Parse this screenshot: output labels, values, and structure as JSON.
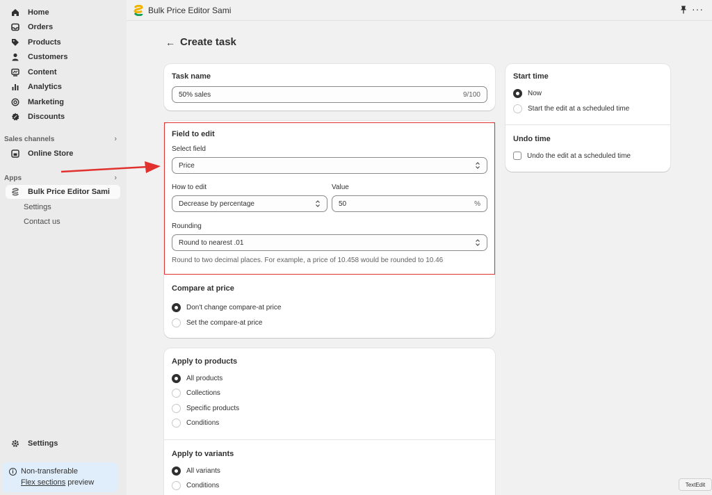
{
  "sidebar": {
    "items": [
      {
        "label": "Home",
        "icon": "home-icon"
      },
      {
        "label": "Orders",
        "icon": "orders-icon"
      },
      {
        "label": "Products",
        "icon": "tag-icon"
      },
      {
        "label": "Customers",
        "icon": "person-icon"
      },
      {
        "label": "Content",
        "icon": "content-icon"
      },
      {
        "label": "Analytics",
        "icon": "bar-chart-icon"
      },
      {
        "label": "Marketing",
        "icon": "target-icon"
      },
      {
        "label": "Discounts",
        "icon": "discount-icon"
      }
    ],
    "sales_channels_label": "Sales channels",
    "online_store": "Online Store",
    "apps_label": "Apps",
    "app_name": "Bulk Price Editor Sami",
    "app_settings": "Settings",
    "app_contact": "Contact us",
    "settings": "Settings",
    "notice_line1": "Non-transferable",
    "notice_link": "Flex sections",
    "notice_suffix": " preview"
  },
  "topbar": {
    "title": "Bulk Price Editor Sami"
  },
  "page": {
    "title": "Create task"
  },
  "task_name": {
    "title": "Task name",
    "value": "50% sales",
    "counter": "9/100"
  },
  "field_to_edit": {
    "title": "Field to edit",
    "select_label": "Select field",
    "select_value": "Price",
    "how_label": "How to edit",
    "how_value": "Decrease by percentage",
    "value_label": "Value",
    "value": "50",
    "value_suffix": "%",
    "rounding_label": "Rounding",
    "rounding_value": "Round to nearest .01",
    "rounding_help": "Round to two decimal places. For example, a price of 10.458 would be rounded to 10.46"
  },
  "compare_at": {
    "title": "Compare at price",
    "options": [
      "Don't change compare-at price",
      "Set the compare-at price"
    ],
    "selected": 0
  },
  "apply_products": {
    "title": "Apply to products",
    "options": [
      "All products",
      "Collections",
      "Specific products",
      "Conditions"
    ],
    "selected": 0
  },
  "apply_variants": {
    "title": "Apply to variants",
    "options": [
      "All variants",
      "Conditions"
    ],
    "selected": 0
  },
  "start_time": {
    "title": "Start time",
    "options": [
      "Now",
      "Start the edit at a scheduled time"
    ],
    "selected": 0
  },
  "undo_time": {
    "title": "Undo time",
    "checkbox": "Undo the edit at a scheduled time"
  },
  "tooltip": "TextEdit",
  "colors": {
    "highlight": "#e0312f",
    "arrow": "#e0312f",
    "sidebar_bg": "#ebebeb",
    "notice_bg": "#e0eefb"
  }
}
